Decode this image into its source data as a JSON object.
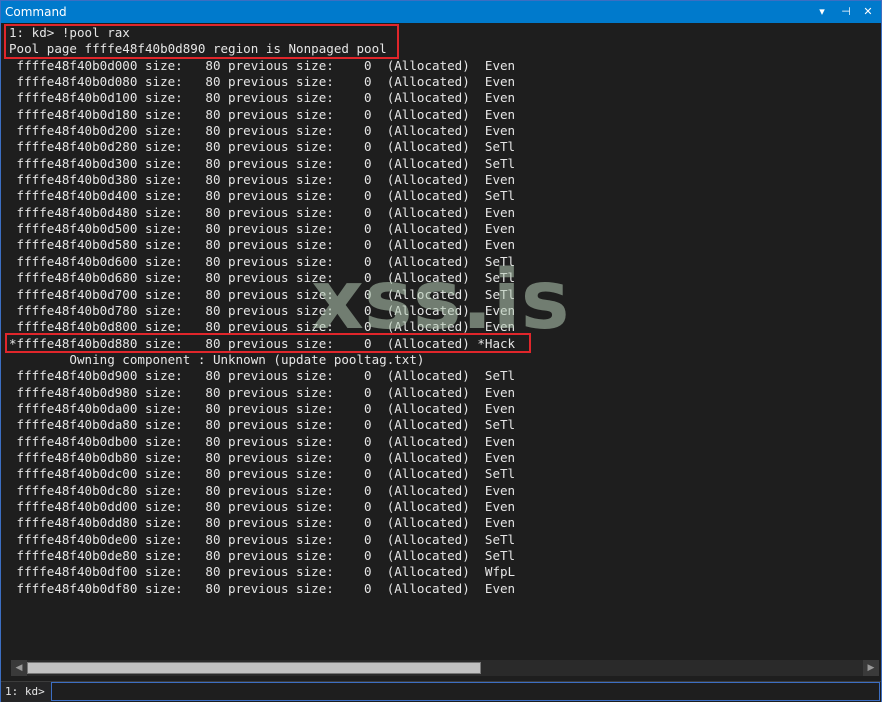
{
  "window": {
    "title": "Command",
    "controls": {
      "dropdown": "▾",
      "pin": "⊣",
      "close": "✕"
    }
  },
  "output": {
    "lines": [
      "1: kd> !pool rax",
      "Pool page ffffe48f40b0d890 region is Nonpaged pool",
      " ffffe48f40b0d000 size:   80 previous size:    0  (Allocated)  Even",
      " ffffe48f40b0d080 size:   80 previous size:    0  (Allocated)  Even",
      " ffffe48f40b0d100 size:   80 previous size:    0  (Allocated)  Even",
      " ffffe48f40b0d180 size:   80 previous size:    0  (Allocated)  Even",
      " ffffe48f40b0d200 size:   80 previous size:    0  (Allocated)  Even",
      " ffffe48f40b0d280 size:   80 previous size:    0  (Allocated)  SeTl",
      " ffffe48f40b0d300 size:   80 previous size:    0  (Allocated)  SeTl",
      " ffffe48f40b0d380 size:   80 previous size:    0  (Allocated)  Even",
      " ffffe48f40b0d400 size:   80 previous size:    0  (Allocated)  SeTl",
      " ffffe48f40b0d480 size:   80 previous size:    0  (Allocated)  Even",
      " ffffe48f40b0d500 size:   80 previous size:    0  (Allocated)  Even",
      " ffffe48f40b0d580 size:   80 previous size:    0  (Allocated)  Even",
      " ffffe48f40b0d600 size:   80 previous size:    0  (Allocated)  SeTl",
      " ffffe48f40b0d680 size:   80 previous size:    0  (Allocated)  SeTl",
      " ffffe48f40b0d700 size:   80 previous size:    0  (Allocated)  SeTl",
      " ffffe48f40b0d780 size:   80 previous size:    0  (Allocated)  Even",
      " ffffe48f40b0d800 size:   80 previous size:    0  (Allocated)  Even",
      "*ffffe48f40b0d880 size:   80 previous size:    0  (Allocated) *Hack",
      "        Owning component : Unknown (update pooltag.txt)",
      " ffffe48f40b0d900 size:   80 previous size:    0  (Allocated)  SeTl",
      " ffffe48f40b0d980 size:   80 previous size:    0  (Allocated)  Even",
      " ffffe48f40b0da00 size:   80 previous size:    0  (Allocated)  Even",
      " ffffe48f40b0da80 size:   80 previous size:    0  (Allocated)  SeTl",
      " ffffe48f40b0db00 size:   80 previous size:    0  (Allocated)  Even",
      " ffffe48f40b0db80 size:   80 previous size:    0  (Allocated)  Even",
      " ffffe48f40b0dc00 size:   80 previous size:    0  (Allocated)  SeTl",
      " ffffe48f40b0dc80 size:   80 previous size:    0  (Allocated)  Even",
      " ffffe48f40b0dd00 size:   80 previous size:    0  (Allocated)  Even",
      " ffffe48f40b0dd80 size:   80 previous size:    0  (Allocated)  Even",
      " ffffe48f40b0de00 size:   80 previous size:    0  (Allocated)  SeTl",
      " ffffe48f40b0de80 size:   80 previous size:    0  (Allocated)  SeTl",
      " ffffe48f40b0df00 size:   80 previous size:    0  (Allocated)  WfpL",
      " ffffe48f40b0df80 size:   80 previous size:    0  (Allocated)  Even"
    ]
  },
  "watermark": "xss.is",
  "scrollbar": {
    "left_arrow": "◀",
    "right_arrow": "▶"
  },
  "command_bar": {
    "prompt": "1: kd>",
    "input_value": ""
  },
  "colors": {
    "titlebar": "#007acc",
    "background": "#1e1e1e",
    "highlight_box": "#e0262b",
    "text": "#e6e6e6"
  }
}
